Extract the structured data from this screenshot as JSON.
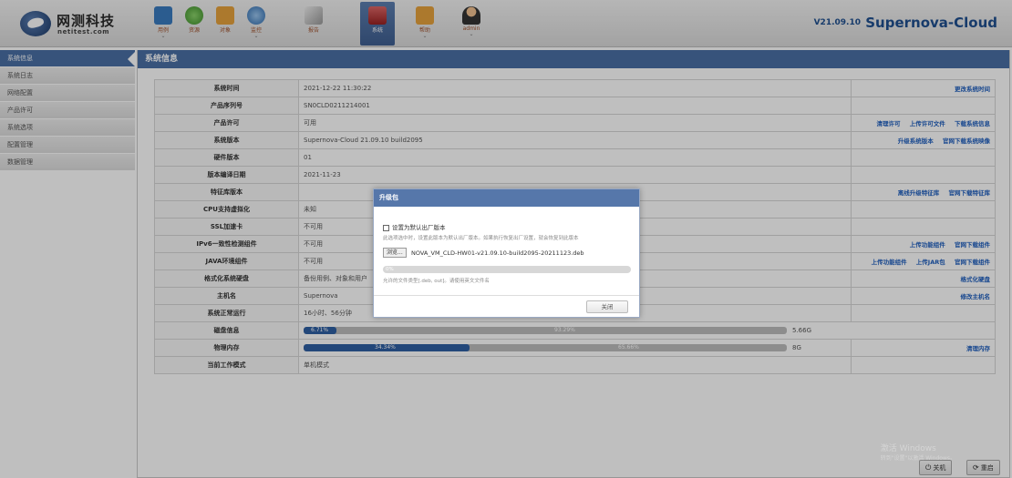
{
  "brand": {
    "name_cn": "网测科技",
    "name_en": "netitest.com"
  },
  "nav": [
    {
      "label": "用例",
      "icon": "testcase-icon",
      "color": "#3a7bbf"
    },
    {
      "label": "资源",
      "icon": "resource-icon",
      "color": "#4caf50"
    },
    {
      "label": "对象",
      "icon": "object-icon",
      "color": "#e6a23c"
    },
    {
      "label": "监控",
      "icon": "monitor-icon",
      "color": "#4b8bd0"
    },
    {
      "label": "报告",
      "icon": "report-icon",
      "color": "#8a8a8a"
    },
    {
      "label": "系统",
      "icon": "system-icon",
      "color": "#c94a4a"
    },
    {
      "label": "帮助",
      "icon": "help-icon",
      "color": "#e6a23c"
    },
    {
      "label": "admin",
      "icon": "user-icon",
      "color": "#b5651d"
    }
  ],
  "version": {
    "number": "V21.09.10",
    "product": "Supernova-Cloud"
  },
  "sidebar": [
    "系统信息",
    "系统日志",
    "网络配置",
    "产品许可",
    "系统选项",
    "配置管理",
    "数据管理"
  ],
  "panel_title": "系统信息",
  "rows": {
    "time": {
      "k": "系统时间",
      "v": "2021-12-22 11:30:22",
      "a1": "更改系统时间"
    },
    "serial": {
      "k": "产品序列号",
      "v": "SN0CLD0211214001"
    },
    "license": {
      "k": "产品许可",
      "v": "可用",
      "a1": "清理许可",
      "a2": "上传许可文件",
      "a3": "下载系统信息"
    },
    "sysver": {
      "k": "系统版本",
      "v": "Supernova-Cloud 21.09.10 build2095",
      "a1": "升级系统版本",
      "a2": "官网下载系统映像"
    },
    "hwver": {
      "k": "硬件版本",
      "v": "01"
    },
    "builddate": {
      "k": "版本编译日期",
      "v": "2021-11-23"
    },
    "featlib": {
      "k": "特征库版本",
      "v": "",
      "a1": "离线升级特征库",
      "a2": "官网下载特征库"
    },
    "cpuvirt": {
      "k": "CPU支持虚拟化",
      "v": "未知"
    },
    "ssl": {
      "k": "SSL加速卡",
      "v": "不可用"
    },
    "ipv6": {
      "k": "IPv6一致性检测组件",
      "v": "不可用",
      "a1": "上传功能组件",
      "a2": "官网下载组件"
    },
    "java": {
      "k": "JAVA环境组件",
      "v": "不可用",
      "a1": "上传功能组件",
      "a2": "上传JAR包",
      "a3": "官网下载组件"
    },
    "format": {
      "k": "格式化系统硬盘",
      "v": "备份用例、对象和用户",
      "a1": "格式化硬盘"
    },
    "host": {
      "k": "主机名",
      "v": "Supernova",
      "a1": "修改主机名"
    },
    "uptime": {
      "k": "系统正常运行",
      "v": "16小时、56分钟"
    },
    "disk": {
      "k": "磁盘信息",
      "used_label": "6.71%",
      "free_label": "93.29%",
      "used_pct": 6.71,
      "total": "5.66G"
    },
    "mem": {
      "k": "物理内存",
      "used_label": "34.34%",
      "free_label": "65.66%",
      "used_pct": 34.34,
      "total": "8G",
      "a1": "清理内存"
    },
    "mode": {
      "k": "当前工作模式",
      "v": "单机模式"
    }
  },
  "buttons": {
    "shutdown": "关机",
    "restart": "重启"
  },
  "dialog": {
    "title": "升级包",
    "checkbox_label": "设置为默认出厂版本",
    "checked": false,
    "hint": "此选项选中时，设置此版本为默认出厂版本。如果执行恢复出厂设置，就会恢复到此版本",
    "browse": "浏览...",
    "filename": "NOVA_VM_CLD-HW01-v21.09.10-build2095-20211123.deb",
    "progress_label": "0%",
    "progress": 0,
    "types": "允许的文件类型[.deb, out]。请使用英文文件名",
    "close": "关闭"
  },
  "watermark": {
    "line1": "激活 Windows",
    "line2": "转到\"设置\"以激活 Windows。"
  }
}
